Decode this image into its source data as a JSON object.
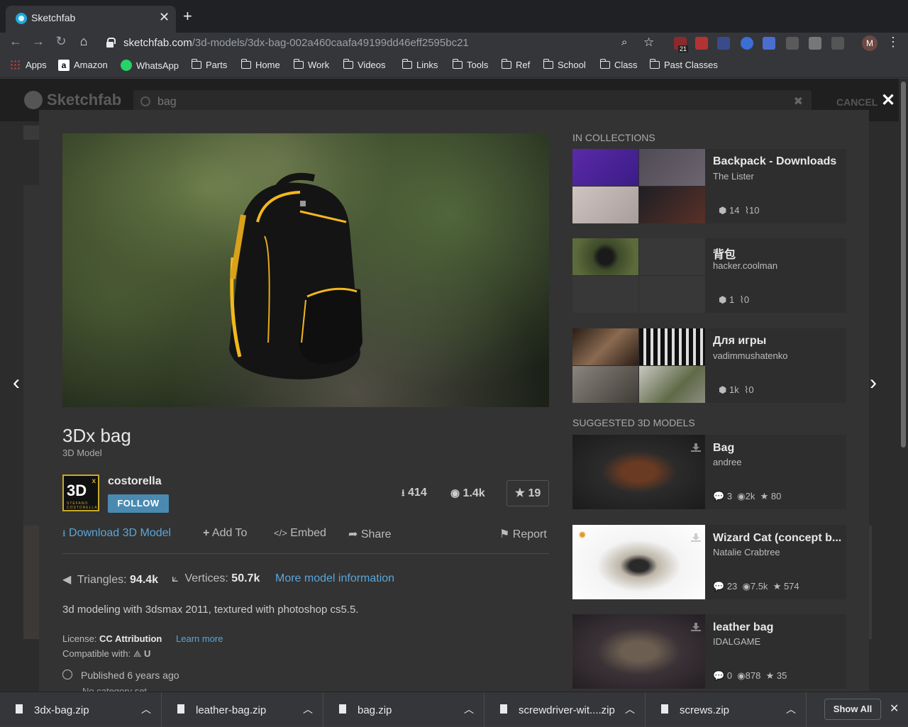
{
  "browser": {
    "tab_title": "Sketchfab",
    "url_host": "sketchfab.com",
    "url_path": "/3d-models/3dx-bag-002a460caafa49199dd46eff2595bc21",
    "profile_initial": "M",
    "ext_badge": "21",
    "bookmarks": [
      "Apps",
      "Amazon",
      "WhatsApp",
      "Parts",
      "Home",
      "Work",
      "Videos",
      "Links",
      "Tools",
      "Ref",
      "School",
      "Class",
      "Past Classes"
    ]
  },
  "site": {
    "logo": "Sketchfab",
    "search_query": "bag",
    "cancel_label": "CANCEL"
  },
  "model": {
    "title": "3Dx bag",
    "subtitle": "3D Model",
    "author": "costorella",
    "avatar_text": "3D",
    "avatar_sup": "x",
    "avatar_sub": "STEFANO COSTORELLA",
    "follow_label": "FOLLOW",
    "downloads": "414",
    "views": "1.4k",
    "likes": "19",
    "actions": {
      "download": "Download 3D Model",
      "add_to": "Add To",
      "embed": "Embed",
      "share": "Share",
      "report": "Report"
    },
    "triangles_label": "Triangles:",
    "triangles": "94.4k",
    "vertices_label": "Vertices:",
    "vertices": "50.7k",
    "more_info": "More model information",
    "description": "3d modeling with 3dsmax 2011, textured with photoshop cs5.5.",
    "license_label": "License:",
    "license": "CC Attribution",
    "learn_more": "Learn more",
    "compatible_label": "Compatible with:",
    "published": "Published 6 years ago",
    "category": "No category set"
  },
  "collections": {
    "heading": "IN COLLECTIONS",
    "items": [
      {
        "name": "Backpack - Downloads",
        "owner": "The Lister",
        "models": "14",
        "followers": "10"
      },
      {
        "name": "背包",
        "owner": "hacker.coolman",
        "models": "1",
        "followers": "0"
      },
      {
        "name": "Для игры",
        "owner": "vadimmushatenko",
        "models": "1k",
        "followers": "0"
      }
    ]
  },
  "suggested": {
    "heading": "SUGGESTED 3D MODELS",
    "items": [
      {
        "name": "Bag",
        "owner": "andree",
        "comments": "3",
        "views": "2k",
        "likes": "80"
      },
      {
        "name": "Wizard Cat (concept b...",
        "owner": "Natalie Crabtree",
        "comments": "23",
        "views": "7.5k",
        "likes": "574"
      },
      {
        "name": "leather bag",
        "owner": "IDALGAME",
        "comments": "0",
        "views": "878",
        "likes": "35"
      }
    ]
  },
  "downloads_shelf": {
    "files": [
      "3dx-bag.zip",
      "leather-bag.zip",
      "bag.zip",
      "screwdriver-wit....zip",
      "screws.zip"
    ],
    "show_all": "Show All"
  },
  "colors": {
    "accent_link": "#5aa5d8",
    "follow_button": "#4a8ab0",
    "bag_zipper": "#f2b81c"
  }
}
